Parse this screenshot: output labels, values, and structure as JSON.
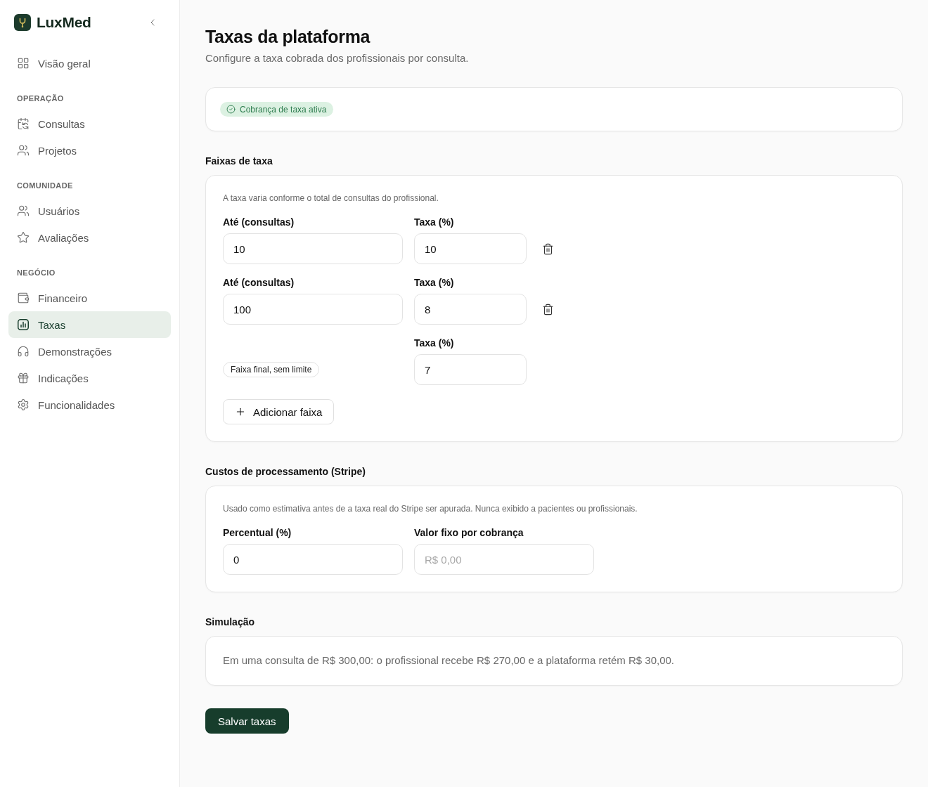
{
  "sidebar": {
    "brand": "LuxMed",
    "groups": [
      {
        "items": [
          {
            "label": "Visão geral",
            "selected": false
          }
        ]
      },
      {
        "heading": "OPERAÇÃO",
        "items": [
          {
            "label": "Consultas",
            "selected": false
          },
          {
            "label": "Projetos",
            "selected": false
          }
        ]
      },
      {
        "heading": "COMUNIDADE",
        "items": [
          {
            "label": "Usuários",
            "selected": false
          },
          {
            "label": "Avaliações",
            "selected": false
          }
        ]
      },
      {
        "heading": "NEGÓCIO",
        "items": [
          {
            "label": "Financeiro",
            "selected": false
          },
          {
            "label": "Taxas",
            "selected": true
          },
          {
            "label": "Demonstrações",
            "selected": false
          },
          {
            "label": "Indicações",
            "selected": false
          },
          {
            "label": "Funcionalidades",
            "selected": false
          }
        ]
      }
    ]
  },
  "page": {
    "title": "Taxas da plataforma",
    "subtitle": "Configure a taxa cobrada dos profissionais por consulta."
  },
  "status_card": {
    "badge": "Cobrança de taxa ativa"
  },
  "fee_tiers": {
    "heading": "Faixas de taxa",
    "description": "A taxa varia conforme o total de consultas do profissional.",
    "tiers": [
      {
        "kind": "limited",
        "limit_label": "Até (consultas)",
        "limit_value": "10",
        "rate_label": "Taxa (%)",
        "rate_value": "10"
      },
      {
        "kind": "limited",
        "limit_label": "Até (consultas)",
        "limit_value": "100",
        "rate_label": "Taxa (%)",
        "rate_value": "8"
      },
      {
        "kind": "final",
        "final_badge": "Faixa final, sem limite",
        "rate_label": "Taxa (%)",
        "rate_value": "7"
      }
    ],
    "add_button": "Adicionar faixa"
  },
  "processing_costs": {
    "heading": "Custos de processamento (Stripe)",
    "description": "Usado como estimativa antes de a taxa real do Stripe ser apurada. Nunca exibido a pacientes ou profissionais.",
    "fields": [
      {
        "label": "Percentual (%)",
        "value": "0"
      },
      {
        "label": "Valor fixo por cobrança",
        "placeholder": "R$ 0,00"
      }
    ]
  },
  "simulation": {
    "heading": "Simulação",
    "text": "Em uma consulta de R$ 300,00: o profissional recebe R$ 270,00 e a plataforma retém R$ 30,00."
  },
  "save_button": "Salvar taxas"
}
